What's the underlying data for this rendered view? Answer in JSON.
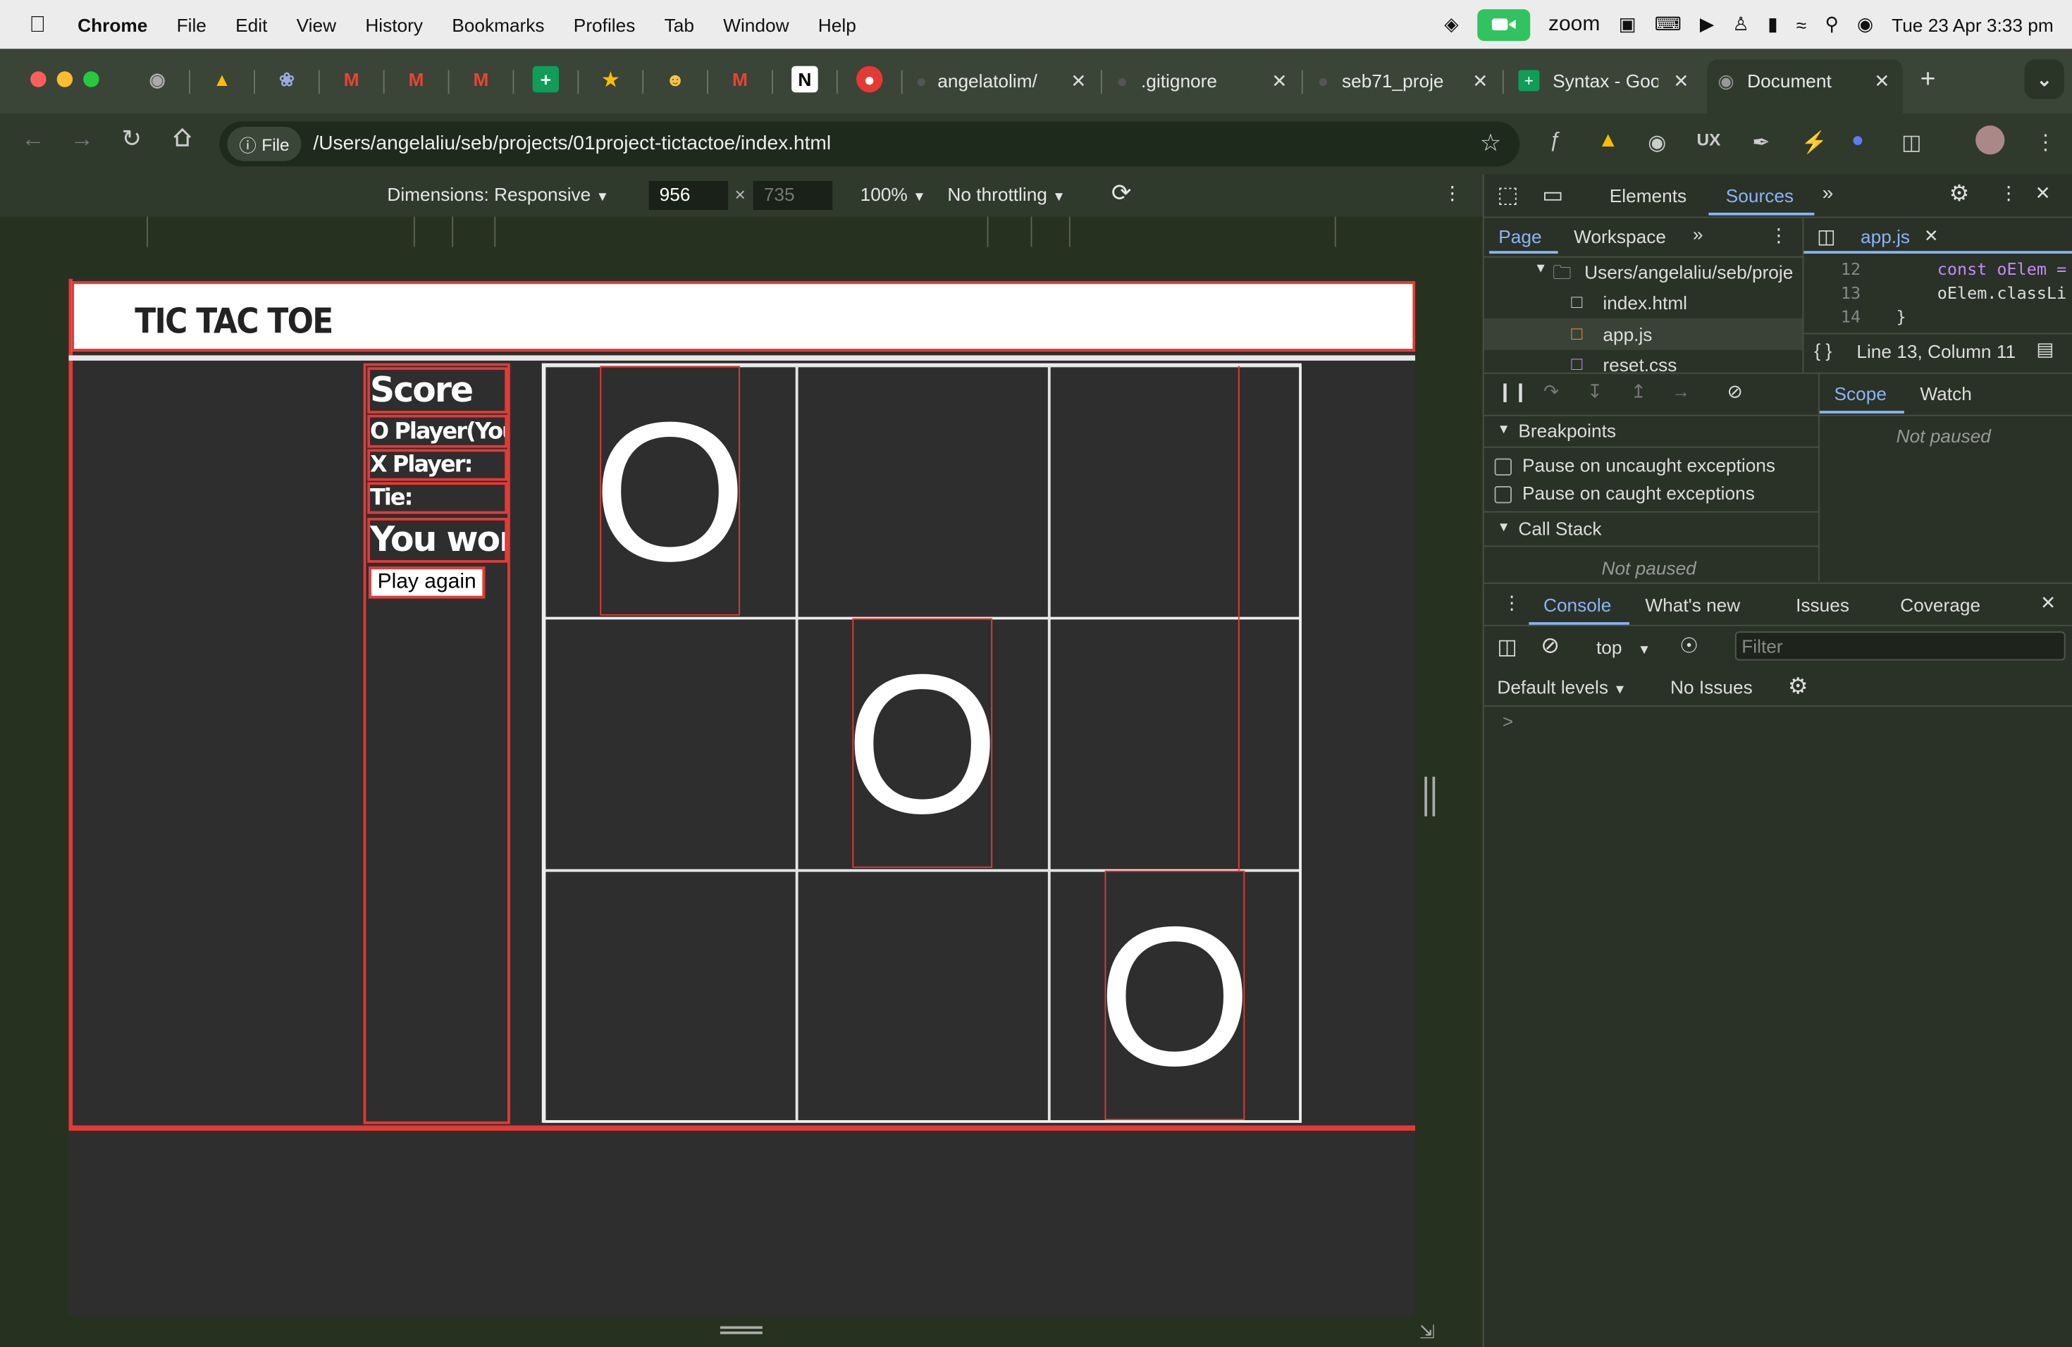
{
  "menubar": {
    "app": "Chrome",
    "items": [
      "File",
      "Edit",
      "View",
      "History",
      "Bookmarks",
      "Profiles",
      "Tab",
      "Window",
      "Help"
    ],
    "zoom": "zoom",
    "datetime": "Tue 23 Apr  3:33 pm"
  },
  "tabs": [
    {
      "label": "angelatolim/"
    },
    {
      "label": ".gitignore"
    },
    {
      "label": "seb71_proje"
    },
    {
      "label": "Syntax - Goo"
    },
    {
      "label": "Document"
    }
  ],
  "toolbar": {
    "file_chip": "File",
    "url": "/Users/angelaliu/seb/projects/01project-tictactoe/index.html"
  },
  "emulation": {
    "dimensions": "Dimensions: Responsive",
    "width": "956",
    "height": "735",
    "zoom": "100%",
    "throttling": "No throttling"
  },
  "game": {
    "title": "TIC TAC TOE",
    "score_heading": "Score",
    "o_player": "O Player(You):",
    "x_player": "X Player:",
    "tie": "Tie:",
    "result": "You won!",
    "play_again": "Play again",
    "board": [
      "O",
      "",
      "",
      "",
      "O",
      "",
      "",
      "",
      "O"
    ]
  },
  "devtools": {
    "tabs": [
      "Elements",
      "Sources"
    ],
    "active_tab": "Sources",
    "nav_tabs": [
      "Page",
      "Workspace"
    ],
    "tree_root": "Users/angelaliu/seb/proje",
    "files": [
      "index.html",
      "app.js",
      "reset.css"
    ],
    "open_file": "app.js",
    "code_lines": [
      {
        "num": "12",
        "code": "const oElem ="
      },
      {
        "num": "13",
        "code": "oElem.classLi"
      },
      {
        "num": "14",
        "code": "}"
      }
    ],
    "cursor_pos": "Line 13, Column 11",
    "scope": "Scope",
    "watch": "Watch",
    "not_paused": "Not paused",
    "breakpoints": "Breakpoints",
    "pause_uncaught": "Pause on uncaught exceptions",
    "pause_caught": "Pause on caught exceptions",
    "call_stack": "Call Stack",
    "drawer_tabs": [
      "Console",
      "What's new",
      "Issues",
      "Coverage"
    ],
    "context": "top",
    "filter_placeholder": "Filter",
    "levels": "Default levels",
    "issues": "No Issues",
    "prompt": ">"
  }
}
